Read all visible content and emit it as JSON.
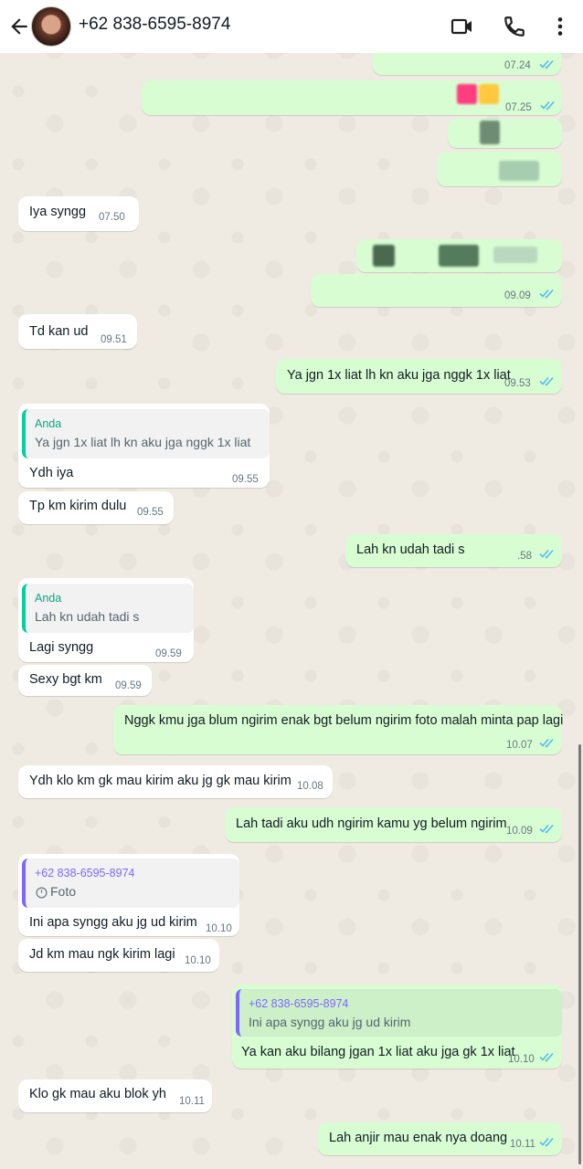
{
  "header": {
    "contact": "+62 838-6595-8974"
  },
  "messages": [
    {
      "text": "",
      "time": "07.24"
    },
    {
      "text": "",
      "time": "07.25"
    },
    {
      "text": "Iya syngg",
      "time": "07.50"
    },
    {
      "text": "",
      "time": "09.09"
    },
    {
      "text": "Td kan ud",
      "time": "09.51"
    },
    {
      "text": "Ya jgn 1x liat lh kn aku jga nggk 1x liat",
      "time": "09.53"
    },
    {
      "quote_author": "Anda",
      "quote_text": "Ya jgn 1x liat lh kn aku jga nggk 1x liat",
      "text": "Ydh iya",
      "time": "09.55"
    },
    {
      "text": "Tp km kirim dulu",
      "time": "09.55"
    },
    {
      "text": "Lah kn udah tadi s",
      "time": ".58"
    },
    {
      "quote_author": "Anda",
      "quote_text": "Lah kn udah tadi s",
      "text": "Lagi syngg",
      "time": "09.59"
    },
    {
      "text": "Sexy bgt km",
      "time": "09.59"
    },
    {
      "text": "Nggk kmu jga blum ngirim enak bgt belum ngirim foto malah minta pap lagi",
      "time": "10.07"
    },
    {
      "text": "Ydh klo km gk mau kirim aku jg gk mau kirim",
      "time": "10.08"
    },
    {
      "text": "Lah tadi aku udh ngirim kamu yg belum ngirim",
      "time": "10.09"
    },
    {
      "quote_author": "+62 838-6595-8974",
      "quote_text": "Foto",
      "text": "Ini apa syngg aku jg ud kirim",
      "time": "10.10"
    },
    {
      "text": "Jd km mau ngk kirim lagi",
      "time": "10.10"
    },
    {
      "quote_author": "+62 838-6595-8974",
      "quote_text": "Ini apa syngg aku jg ud kirim",
      "text": "Ya kan aku bilang jgan 1x liat aku jga gk 1x liat",
      "time": "10.10"
    },
    {
      "text": "Klo gk mau  aku blok yh",
      "time": "10.11"
    },
    {
      "text": "Lah anjir mau enak nya doang",
      "time": "10.11"
    }
  ],
  "colors": {
    "incoming_bubble": "#ffffff",
    "outgoing_bubble": "#d9fdd3",
    "read_tick": "#53bdeb",
    "chat_bg": "#efeae2"
  },
  "icons": [
    "back-arrow-icon",
    "video-call-icon",
    "phone-icon",
    "more-options-icon",
    "double-check-icon",
    "clock-icon"
  ]
}
